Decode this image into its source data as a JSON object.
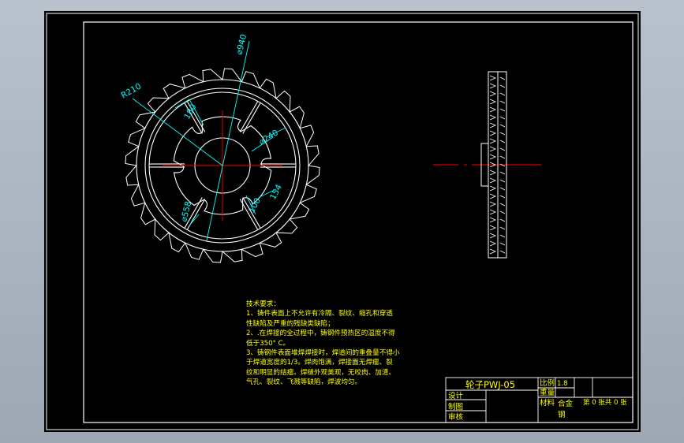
{
  "colors": {
    "background": "#000000",
    "outline": "#ffffff",
    "dimension": "#00ffff",
    "centerline": "#ff0000",
    "note_text": "#ffff00",
    "title_text": "#ffff00"
  },
  "dimensions": {
    "outer_diameter": "⌀940",
    "fillet_radius": "R210",
    "spoke_width": "180",
    "hub_diameter": "⌀240",
    "slot_width": "100",
    "slot_length": "154",
    "inner_diameter": "⌀558"
  },
  "notes": {
    "title": "技术要求：",
    "lines": [
      "1、铸件表面上不允许有冷隔、裂纹、缩孔和穿透",
      "性缺陷及严重的残缺类缺陷；",
      "2、.在焊接的全过程中，铸钢件预热区的温度不得",
      "低于350° C。",
      "3、铸钢件表面堆焊焊接时，焊道间的重叠量不得小",
      "于焊道宽度的1/3。焊肉饱满，焊接面无焊瘤、裂",
      "纹和明显的结瘤。焊缝外观美观，无咬肉、加渣、",
      "气孔、裂纹、飞溅等缺陷，焊波均匀。"
    ]
  },
  "title_block": {
    "part_name": "轮子PWJ-05",
    "scale_label": "比例",
    "scale_value": "1.8",
    "weight_label": "重量",
    "material_label": "材料",
    "material_value": "合金",
    "material_value2": "钢",
    "sheet_info": "第 0 张共 0 张",
    "design_label": "设计",
    "drawing_label": "制图",
    "review_label": "审核"
  }
}
